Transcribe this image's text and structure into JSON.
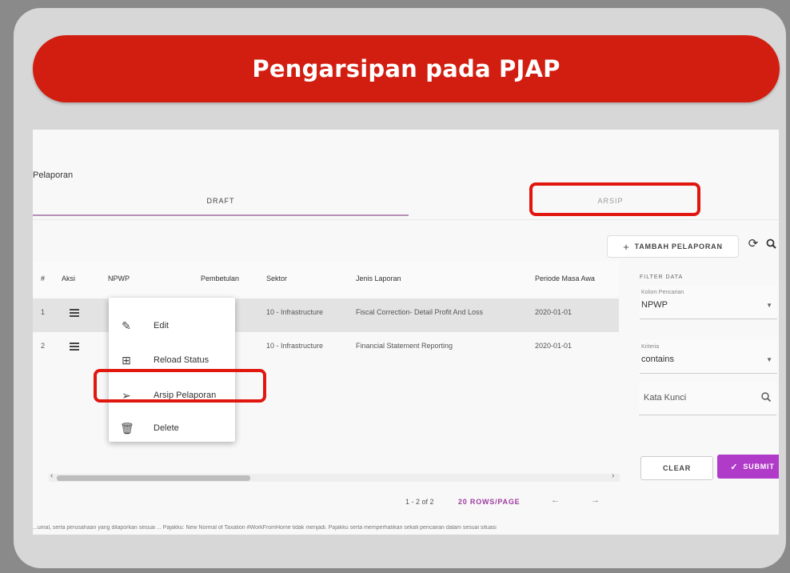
{
  "banner": {
    "title": "Pengarsipan pada PJAP"
  },
  "section": {
    "title": "Pelaporan"
  },
  "tabs": {
    "draft": "DRAFT",
    "arsip": "ARSIP"
  },
  "toolbar": {
    "add_label": "TAMBAH PELAPORAN",
    "add_icon": "plus-icon",
    "refresh_icon": "refresh-icon",
    "search_icon": "search-icon"
  },
  "table": {
    "headers": {
      "no": "#",
      "aksi": "Aksi",
      "npwp": "NPWP",
      "pembetulan": "Pembetulan",
      "sektor": "Sektor",
      "jenis": "Jenis Laporan",
      "periode": "Periode Masa Awa"
    },
    "rows": [
      {
        "no": "1",
        "sektor": "10 - Infrastructure",
        "jenis": "Fiscal Correction- Detail Profit And Loss",
        "periode": "2020-01-01"
      },
      {
        "no": "2",
        "sektor": "10 - Infrastructure",
        "jenis": "Financial Statement Reporting",
        "periode": "2020-01-01"
      }
    ]
  },
  "menu": {
    "items": [
      {
        "label": "Edit",
        "icon": "pencil-icon"
      },
      {
        "label": "Reload Status",
        "icon": "reload-icon"
      },
      {
        "label": "Arsip Pelaporan",
        "icon": "send-icon"
      },
      {
        "label": "Delete",
        "icon": "trash-icon"
      }
    ]
  },
  "pagination": {
    "range": "1 - 2 of 2",
    "rows_per_page": "20 ROWS/PAGE"
  },
  "filter": {
    "title": "FILTER DATA",
    "kolom_label": "Kolom Pencarian",
    "kolom_value": "NPWP",
    "kriteria_label": "Kriteria",
    "kriteria_value": "contains",
    "keyword_placeholder": "Kata Kunci",
    "clear_label": "CLEAR",
    "submit_label": "SUBMIT"
  },
  "footer": {
    "ticker": "...umal, serta perusahaan yang dilaporkan sesuai ... Pajakku: New Normal of Taxation #WorkFromHome tidak menjadi. Pajakku serta memperhatikan sekali pencairan dalam sesuai situasi"
  },
  "colors": {
    "banner": "#d21e10",
    "highlight": "#e1160f",
    "accent": "#b03bc9"
  }
}
